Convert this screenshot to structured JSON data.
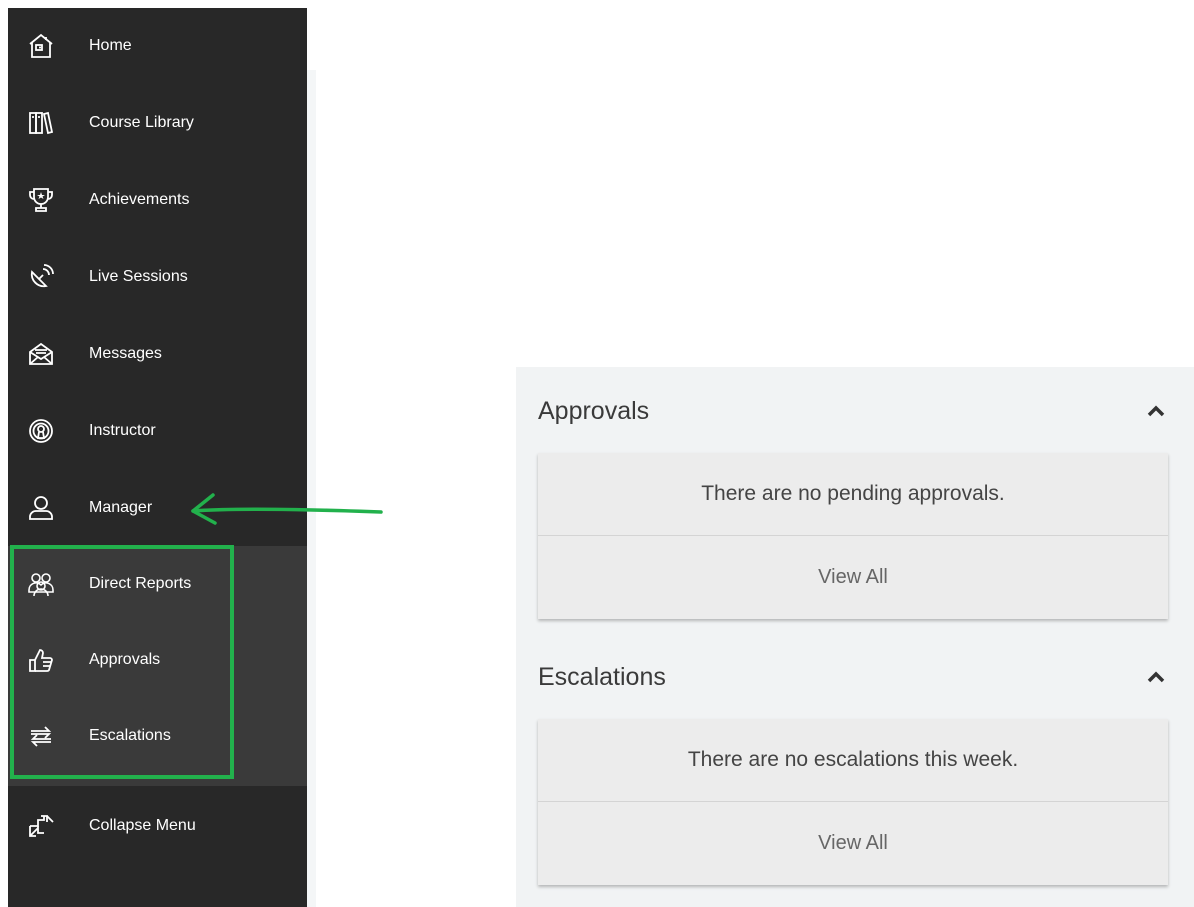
{
  "sidebar": {
    "items": [
      {
        "label": "Home",
        "icon": "home-icon"
      },
      {
        "label": "Course Library",
        "icon": "books-icon"
      },
      {
        "label": "Achievements",
        "icon": "trophy-icon"
      },
      {
        "label": "Live Sessions",
        "icon": "satellite-icon"
      },
      {
        "label": "Messages",
        "icon": "envelope-icon"
      },
      {
        "label": "Instructor",
        "icon": "broadcast-icon"
      },
      {
        "label": "Manager",
        "icon": "user-icon"
      }
    ],
    "submenu": [
      {
        "label": "Direct Reports",
        "icon": "group-icon"
      },
      {
        "label": "Approvals",
        "icon": "thumbs-up-icon"
      },
      {
        "label": "Escalations",
        "icon": "arrows-swap-icon"
      }
    ],
    "collapse": {
      "label": "Collapse Menu",
      "icon": "collapse-icon"
    }
  },
  "annotation": {
    "arrow_color": "#22b14c",
    "box_color": "#22b14c"
  },
  "approvals": {
    "title": "Approvals",
    "message": "There are no pending approvals.",
    "link": "View All"
  },
  "escalations": {
    "title": "Escalations",
    "message": "There are no escalations this week.",
    "link": "View All"
  }
}
